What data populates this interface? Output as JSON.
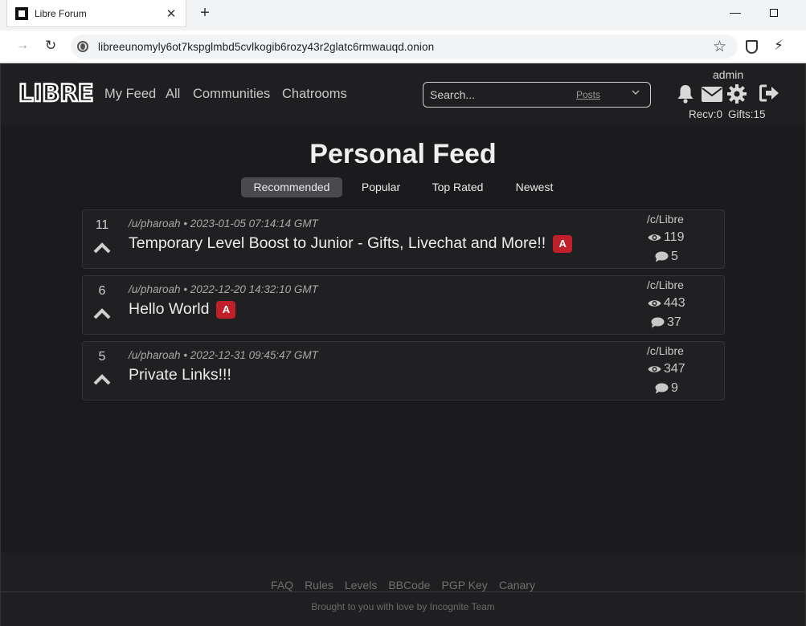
{
  "browser": {
    "tab_title": "Libre Forum",
    "url": "libreeunomyly6ot7kspglmbd5cvlkogib6rozy43r2glatc6rmwauqd.onion"
  },
  "header": {
    "logo": "LIBRE",
    "nav": [
      "My Feed",
      "All",
      "Communities",
      "Chatrooms"
    ],
    "search_placeholder": "Search...",
    "search_type": "Posts",
    "username": "admin",
    "recv": "Recv:0",
    "gifts": "Gifts:15"
  },
  "main": {
    "title": "Personal Feed",
    "sort_tabs": [
      "Recommended",
      "Popular",
      "Top Rated",
      "Newest"
    ],
    "active_tab": "Recommended",
    "posts": [
      {
        "score": "11",
        "author": "/u/pharoah",
        "timestamp": "2023-01-05 07:14:14 GMT",
        "title": "Temporary Level Boost to Junior - Gifts, Livechat and More!!",
        "badge": "A",
        "community": "/c/Libre",
        "views": "119",
        "comments": "5"
      },
      {
        "score": "6",
        "author": "/u/pharoah",
        "timestamp": "2022-12-20 14:32:10 GMT",
        "title": "Hello World",
        "badge": "A",
        "community": "/c/Libre",
        "views": "443",
        "comments": "37"
      },
      {
        "score": "5",
        "author": "/u/pharoah",
        "timestamp": "2022-12-31 09:45:47 GMT",
        "title": "Private Links!!!",
        "badge": "",
        "community": "/c/Libre",
        "views": "347",
        "comments": "9"
      }
    ]
  },
  "footer": {
    "links": [
      "FAQ",
      "Rules",
      "Levels",
      "BBCode",
      "PGP Key",
      "Canary"
    ],
    "credit": "Brought to you with love by Incognite Team"
  },
  "colors": {
    "background": "#1b1b1d",
    "header": "#1f1f21",
    "badge": "#c0202a",
    "active_tab": "#4a4a4e"
  },
  "icons": {
    "browser": [
      "close-icon",
      "plus-icon",
      "minimize-icon",
      "maximize-icon",
      "forward-arrow-icon",
      "reload-icon",
      "onion-icon",
      "star-icon",
      "shield-icon",
      "wand-icon"
    ],
    "header": [
      "bell-icon",
      "mail-icon",
      "gear-icon",
      "logout-icon",
      "chevron-down-icon"
    ],
    "post": [
      "upvote-icon",
      "eye-icon",
      "comment-icon"
    ]
  }
}
